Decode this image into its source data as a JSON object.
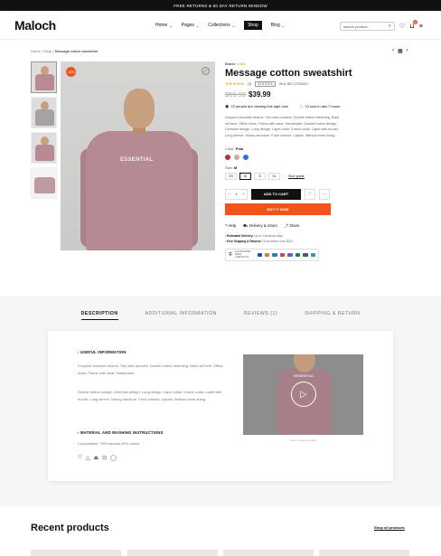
{
  "topbar": {
    "text": "FREE RETURNS & 60 DAY RETURN WINDOW"
  },
  "header": {
    "logo": "Maloch",
    "nav": [
      {
        "label": "Home",
        "active": false
      },
      {
        "label": "Pages",
        "active": false
      },
      {
        "label": "Collections",
        "active": false
      },
      {
        "label": "Shop",
        "active": true
      },
      {
        "label": "Blog",
        "active": false
      }
    ],
    "search_placeholder": "search product...",
    "icons": [
      "search-icon",
      "heart-icon",
      "cart-icon",
      "menu-icon"
    ],
    "cart_count": "1"
  },
  "breadcrumb": {
    "home": "Home",
    "sep": "/",
    "shop": "Shop",
    "current": "Message cotton sweatshirt"
  },
  "gallery": {
    "badge": "-15%"
  },
  "product": {
    "brand_label": "Brand:",
    "brand": "Lolita",
    "title": "Message cotton sweatshirt",
    "stars": "★★★★★",
    "review_count": "(3)",
    "stock": "IN STOCK",
    "sku": "SKU: 887-G7006427",
    "old_price": "$59.99",
    "price": "$39.99",
    "viewing": "22 people are viewing this right now",
    "sold": "24 sold in last 7 hours",
    "description": "Dropped shoulder seams. Two side pockets. Double button fastening. Back slit hem. Office looks. Fabric with wear. Handmade. Double button design. Oversize design. Long design. Lapel collar 3-neck collar. Lapel with mouth. Long sleeve. Heavy structure. Front closure. Lapels. Without inner lining.",
    "color_label": "Color:",
    "color": "Pink",
    "colors": [
      "#b5303a",
      "#c9a9b1",
      "#2f6fd6"
    ],
    "size_label": "Size:",
    "size": "M",
    "sizes": [
      "XS",
      "M",
      "S",
      "XL"
    ],
    "size_guide": "Size guide",
    "qty": "1",
    "add_to_cart": "ADD TO CART",
    "buy_now": "BUY IT NOW",
    "help": "Help",
    "delivery": "Delivery & return",
    "share": "Share",
    "est_label": "Estimated Delivery:",
    "est_value": "Up to 4 business days",
    "ship_label": "Free Shipping & Returns:",
    "ship_value": "On all orders over $200",
    "checkout_text": "GUARANTEE SAFE CHECKOUT",
    "payments": [
      "#1a4fb4",
      "#eb7b1c",
      "#2b7bd8",
      "#e23c3c",
      "#6d5bd0",
      "#0b8a4a",
      "#555555",
      "#1f9bd1"
    ]
  },
  "tabs": [
    {
      "label": "DESCRIPTION",
      "active": true
    },
    {
      "label": "ADDITIONAL INFORMATION",
      "active": false
    },
    {
      "label": "REVIEWS (1)",
      "active": false
    },
    {
      "label": "SHIPPING & RETURN",
      "active": false
    }
  ],
  "tab_content": {
    "useful_title": "USEFUL INFORMATION",
    "useful_p1": "Dropped shoulder seams. Two side pockets. Double button fastening. Back slit hem. Office looks. Fabric with wear. Handmade.",
    "useful_p2": "Double button design. Oversize design. Long design. Lapel collar 3-neck collar. Lapel with mouth. Long sleeve. Heavy structure. Front closure. Lapels. Without inner lining.",
    "material_title": "MATERIAL AND WASHING INSTRUCTIONS",
    "composition": "Composition: 75% viscose,25% cotton",
    "care_icons": [
      "wash-icon",
      "bleach-icon",
      "iron-icon",
      "tumble-dry-icon",
      "dry-clean-icon"
    ],
    "video_caption": "Some model's product"
  },
  "recent": {
    "title": "Recent products",
    "shop_all": "Shop all products"
  }
}
